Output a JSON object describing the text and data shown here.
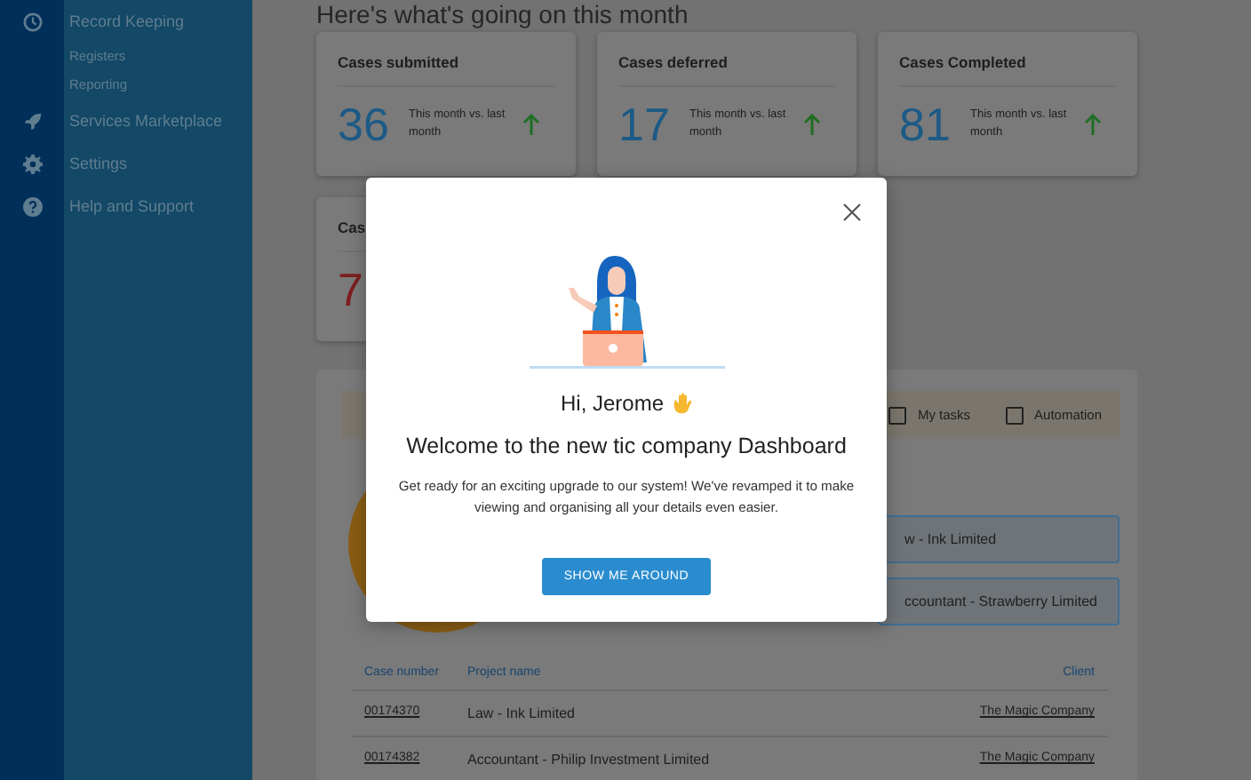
{
  "sidebar": {
    "items": [
      {
        "label": "Record Keeping",
        "kind": "main"
      },
      {
        "label": "Registers",
        "kind": "sub"
      },
      {
        "label": "Reporting",
        "kind": "sub"
      },
      {
        "label": "Services Marketplace",
        "kind": "main"
      },
      {
        "label": "Settings",
        "kind": "main"
      },
      {
        "label": "Help and Support",
        "kind": "main"
      }
    ]
  },
  "heading": "Here's what's going on this month",
  "cards": [
    {
      "title": "Cases submitted",
      "value": "36",
      "note": "This month vs. last month",
      "kind": "rising",
      "color": "#1d5a86"
    },
    {
      "title": "Cases deferred",
      "value": "17",
      "note": "This month vs. last month",
      "kind": "rising",
      "color": "#1d5a86"
    },
    {
      "title": "Cases Completed",
      "value": "81",
      "note": "This month vs. last month",
      "kind": "rising",
      "color": "#1d5a86"
    },
    {
      "title": "Cas",
      "value": "7",
      "kind": "plain",
      "color": "#7d1f1f"
    }
  ],
  "filters": [
    {
      "label": "My tasks",
      "checked": false
    },
    {
      "label": "Automation",
      "checked": false
    }
  ],
  "quick_links": [
    "w - Ink Limited",
    "ccountant - Strawberry Limited"
  ],
  "table": {
    "columns": [
      "Case number",
      "Project name",
      "Client"
    ],
    "rows": [
      [
        "00174370",
        "Law - Ink Limited",
        "The Magic Company"
      ],
      [
        "00174382",
        "Accountant - Philip Investment Limited",
        "The Magic Company"
      ]
    ]
  },
  "modal": {
    "greeting": "Hi, Jerome",
    "title": "Welcome to the new tic company Dashboard",
    "body": "Get ready for an exciting upgrade to our system! We've revamped it to make viewing and organising all your details even easier.",
    "button": "SHOW ME AROUND"
  }
}
